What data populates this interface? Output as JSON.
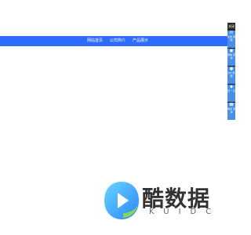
{
  "nav": {
    "items": [
      {
        "label": "网站首页"
      },
      {
        "label": "公司简介"
      },
      {
        "label": "产品展示"
      }
    ]
  },
  "sidebar": {
    "top_label": "关闭",
    "items": [
      {
        "icon": "chat-icon",
        "label": "在线\n客服"
      },
      {
        "icon": "phone-icon",
        "label": "微信\n咨询"
      },
      {
        "icon": "qq-icon",
        "label": "QQ\n客服"
      },
      {
        "icon": "wechat-icon",
        "label": "扫一\n扫"
      },
      {
        "icon": "call-icon",
        "label": "电话\n咨询"
      }
    ]
  },
  "logo": {
    "title": "酷数据",
    "subtitle": "KUIDC",
    "colors": {
      "accent": "#3bb4ff",
      "accent2": "#7ed957"
    }
  },
  "colors": {
    "nav_bg": "#2f6bff",
    "sidebar_bg": "#1e1e1e",
    "sidebar_item": "#4a90e2"
  }
}
